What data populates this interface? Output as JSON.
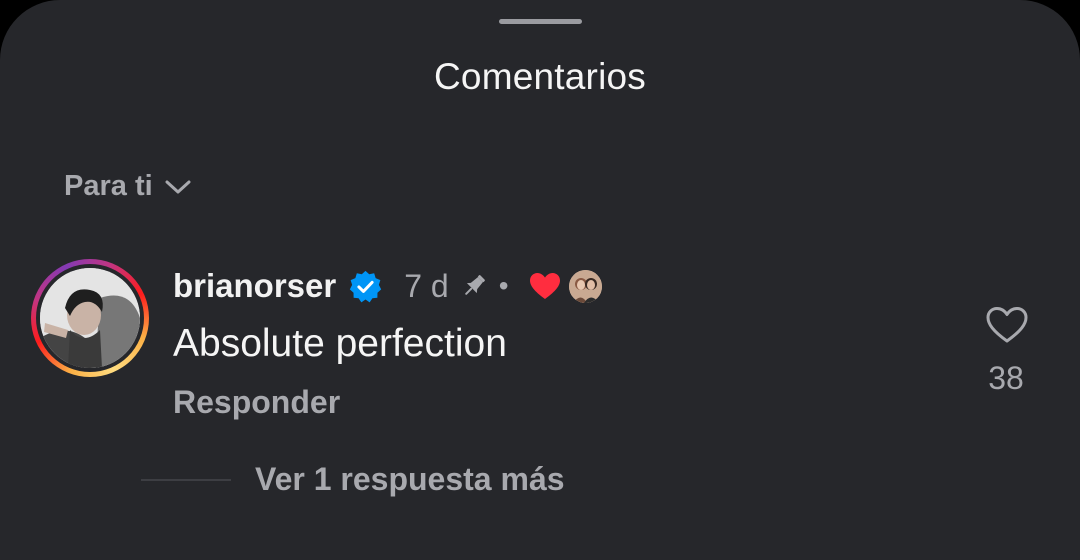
{
  "sheet": {
    "title": "Comentarios",
    "sort_label": "Para ti"
  },
  "comment": {
    "username": "brianorser",
    "verified": true,
    "time": "7 d",
    "dot": "•",
    "pinned": true,
    "liked_by_author": true,
    "text": "Absolute perfection",
    "reply_label": "Responder",
    "like_count": "38",
    "more_replies_label": "Ver 1 respuesta más"
  },
  "colors": {
    "background": "#26272b",
    "verified_badge": "#0095f6",
    "heart": "#ff2d3f",
    "secondary_text": "#a8a9ae"
  },
  "icons": {
    "sort": "chevron-down-icon",
    "verified": "verified-badge-icon",
    "pin": "pin-icon",
    "creator_like": "heart-filled-icon",
    "like": "heart-outline-icon"
  }
}
